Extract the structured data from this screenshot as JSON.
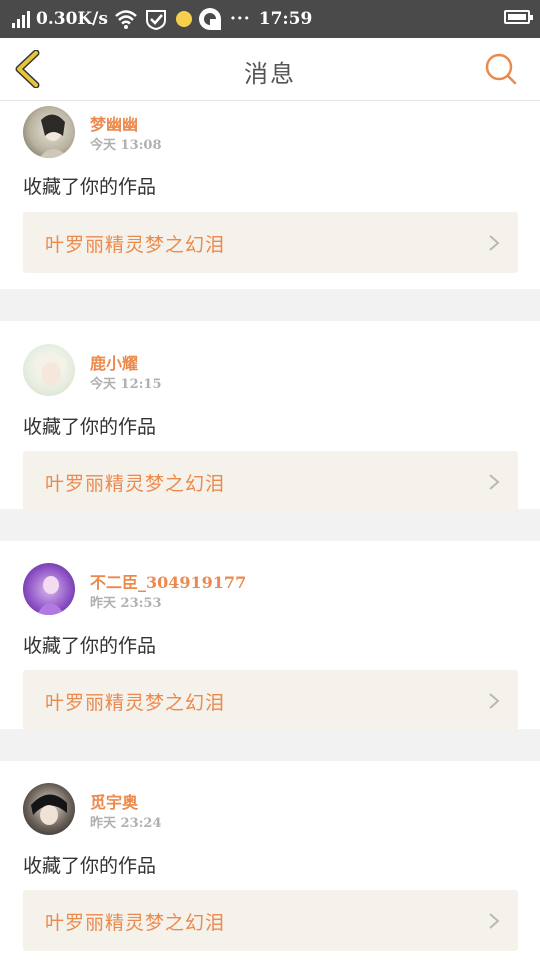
{
  "status_bar": {
    "net_speed": "0.30K/s",
    "dots": "···",
    "time": "17:59"
  },
  "header": {
    "title": "消息",
    "back_icon": "chevron-left-icon",
    "search_icon": "search-icon"
  },
  "colors": {
    "accent": "#ec8a4e",
    "back": "#e8c43a",
    "card_bg": "#f4f2ea"
  },
  "messages": [
    {
      "user": "梦幽幽",
      "time": "今天 13:08",
      "action": "收藏了你的作品",
      "work": "叶罗丽精灵梦之幻泪"
    },
    {
      "user": "鹿小耀",
      "time": "今天 12:15",
      "action": "收藏了你的作品",
      "work": "叶罗丽精灵梦之幻泪"
    },
    {
      "user": "不二臣_304919177",
      "time": "昨天 23:53",
      "action": "收藏了你的作品",
      "work": "叶罗丽精灵梦之幻泪"
    },
    {
      "user": "觅宇奥",
      "time": "昨天 23:24",
      "action": "收藏了你的作品",
      "work": "叶罗丽精灵梦之幻泪"
    }
  ]
}
